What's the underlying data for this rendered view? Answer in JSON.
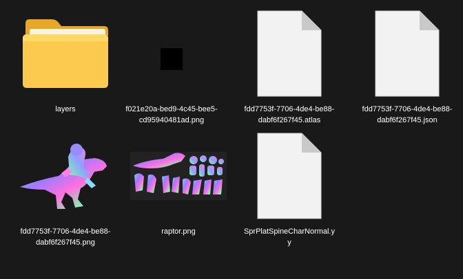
{
  "items": [
    {
      "name": "layers",
      "kind": "folder",
      "icon": "folder-icon"
    },
    {
      "name": "f021e20a-bed9-4c45-bee5-\ncd95940481ad.png",
      "kind": "image",
      "icon": "black-image-thumbnail"
    },
    {
      "name": "fdd7753f-7706-4de4-be88-\ndabf6f267f45.atlas",
      "kind": "file",
      "icon": "blank-document-icon"
    },
    {
      "name": "fdd7753f-7706-4de4-be88-\ndabf6f267f45.json",
      "kind": "file",
      "icon": "blank-document-icon"
    },
    {
      "name": "fdd7753f-7706-4de4-be88-\ndabf6f267f45.png",
      "kind": "image",
      "icon": "raptor-rider-normal-map-thumbnail"
    },
    {
      "name": "raptor.png",
      "kind": "image",
      "icon": "raptor-parts-normal-map-thumbnail"
    },
    {
      "name": "SprPlatSpineCharNormal.y\ny",
      "kind": "file",
      "icon": "blank-document-icon"
    }
  ],
  "colors": {
    "background": "#191919",
    "folder_front": "#f9c94a",
    "folder_back": "#e8a827",
    "document": "#f2f2f2"
  }
}
